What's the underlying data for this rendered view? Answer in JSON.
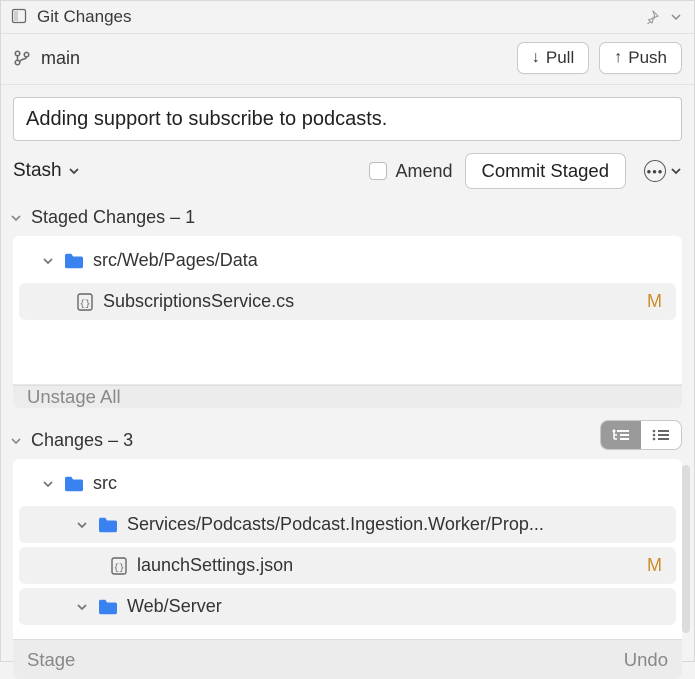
{
  "title": "Git Changes",
  "branch": "main",
  "buttons": {
    "pull": "Pull",
    "push": "Push",
    "commit": "Commit Staged",
    "stash": "Stash",
    "amend": "Amend",
    "unstage_all": "Unstage All",
    "stage": "Stage",
    "undo": "Undo"
  },
  "commit_message": "Adding support to subscribe to podcasts.",
  "staged": {
    "header_prefix": "Staged Changes",
    "count": 1,
    "folder": "src/Web/Pages/Data",
    "file": "SubscriptionsService.cs",
    "file_status": "M"
  },
  "changes": {
    "header_prefix": "Changes",
    "count": 3,
    "root_folder": "src",
    "nested_folder": "Services/Podcasts/Podcast.Ingestion.Worker/Prop...",
    "file1": "launchSettings.json",
    "file1_status": "M",
    "folder2": "Web/Server"
  }
}
